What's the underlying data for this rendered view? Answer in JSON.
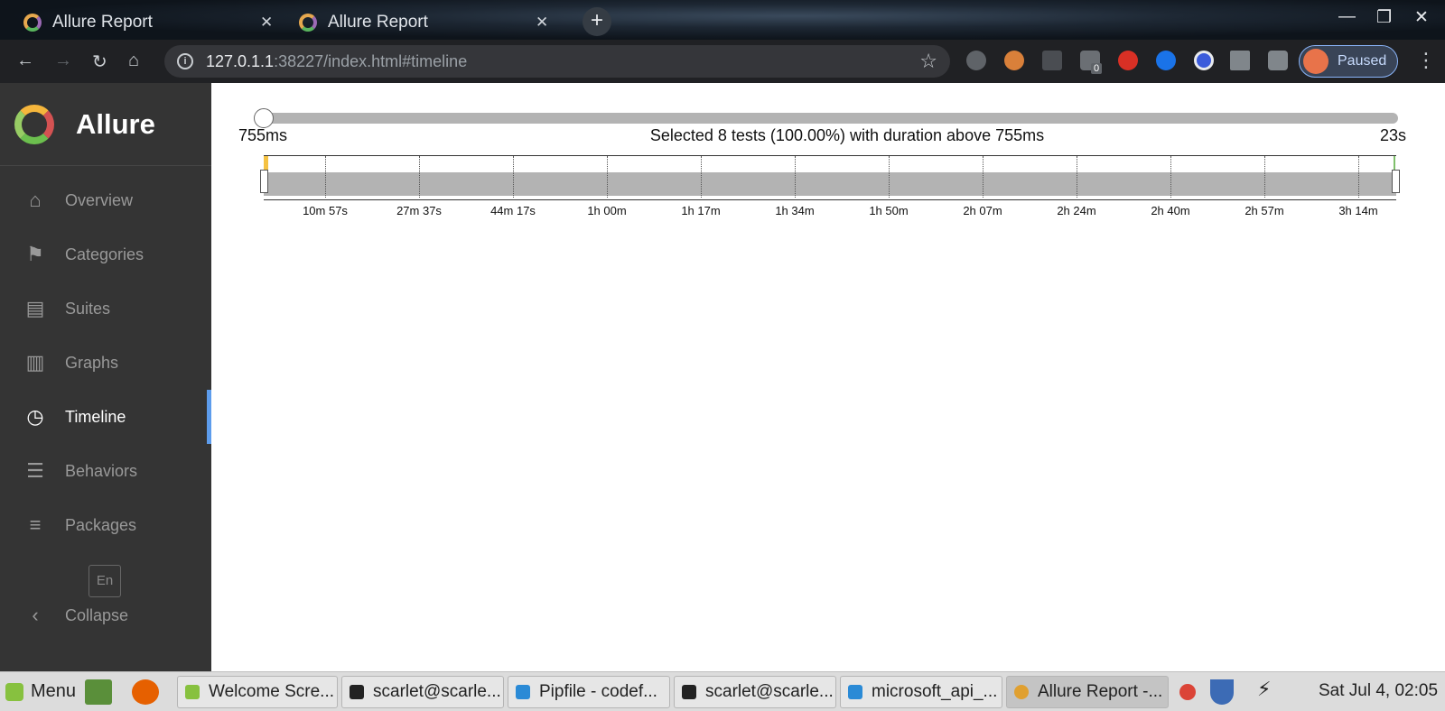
{
  "browser": {
    "tabs": [
      {
        "title": "Allure Report"
      },
      {
        "title": "Allure Report"
      }
    ],
    "new_tab": "+",
    "url_host": "127.0.1.1",
    "url_path": ":38227/index.html#timeline",
    "profile_label": "Paused",
    "ext_badge": "0"
  },
  "sidebar": {
    "brand": "Allure",
    "items": [
      {
        "label": "Overview",
        "icon": "home-icon"
      },
      {
        "label": "Categories",
        "icon": "flag-icon"
      },
      {
        "label": "Suites",
        "icon": "briefcase-icon"
      },
      {
        "label": "Graphs",
        "icon": "bar-chart-icon"
      },
      {
        "label": "Timeline",
        "icon": "clock-icon",
        "active": true
      },
      {
        "label": "Behaviors",
        "icon": "list-icon"
      },
      {
        "label": "Packages",
        "icon": "align-left-icon"
      }
    ],
    "language": "En",
    "collapse": "Collapse"
  },
  "timeline": {
    "min_label": "755ms",
    "max_label": "23s",
    "selection_text": "Selected 8 tests (100.00%) with duration above 755ms",
    "slider_value_fraction": 0,
    "ticks": [
      "10m 57s",
      "27m 37s",
      "44m 17s",
      "1h 00m",
      "1h 17m",
      "1h 34m",
      "1h 50m",
      "2h 07m",
      "2h 24m",
      "2h 40m",
      "2h 57m",
      "3h 14m"
    ]
  },
  "taskbar": {
    "menu": "Menu",
    "tasks": [
      {
        "label": "Welcome Scre..."
      },
      {
        "label": "scarlet@scarle..."
      },
      {
        "label": "Pipfile - codef..."
      },
      {
        "label": "scarlet@scarle..."
      },
      {
        "label": "microsoft_api_..."
      },
      {
        "label": "Allure Report -...",
        "active": true
      }
    ],
    "clock": "Sat Jul  4, 02:05"
  },
  "colors": {
    "sidebar_bg": "#343434",
    "active_accent": "#5d9cec",
    "track": "#b3b3b3",
    "start_marker": "#f5c242",
    "end_marker": "#7fc06b"
  }
}
